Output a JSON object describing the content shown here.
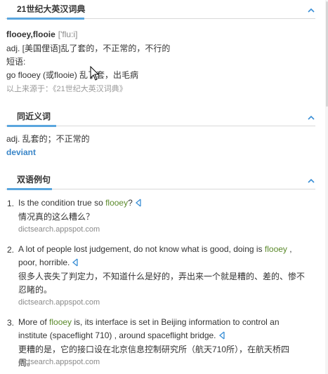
{
  "dict_section": {
    "title": "21世纪大英汉词典",
    "headword": "flooey,flooie",
    "phonetic": "['flu:i]",
    "definition": "adj. [美国俚语]乱了套的，不正常的，不行的",
    "phrase_label": "短语:",
    "phrase": "go flooey (或flooie) 乱了套，出毛病",
    "source": "以上来源于：《21世纪大英汉词典》"
  },
  "synonym_section": {
    "title": "同近义词",
    "definition": "adj. 乱套的；不正常的",
    "link": "deviant"
  },
  "examples_section": {
    "title": "双语例句",
    "items": [
      {
        "num": "1.",
        "en_before": "Is the condition true so ",
        "en_highlight": "flooey",
        "en_after": "?",
        "zh": "情况真的这么糟么？",
        "source": "dictsearch.appspot.com"
      },
      {
        "num": "2.",
        "en_before": "A lot of people lost judgement, do not know what is good, doing is ",
        "en_highlight": "flooey",
        "en_after": " , poor, horrible.",
        "zh": "很多人丧失了判定力，不知道什么是好的，弄出来一个就是糟的、差的、惨不忍睹的。",
        "source": "dictsearch.appspot.com"
      },
      {
        "num": "3.",
        "en_before": "More of ",
        "en_highlight": "flooey",
        "en_after": " is, its interface is set in Beijing information to control an institute (spaceflight 710) , around spaceflight bridge.",
        "zh": "更糟的是，它的接口设在北京信息控制研究所（航天710所），在航天桥四周。",
        "source": "dictsearch.appspot.com"
      }
    ]
  },
  "colors": {
    "accent": "#5aa6de",
    "highlight": "#5b8a2b",
    "link": "#3a86c8"
  }
}
